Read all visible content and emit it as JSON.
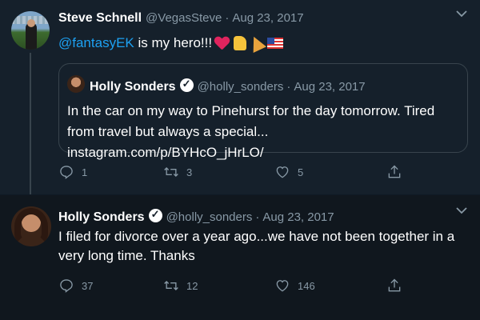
{
  "tweets": [
    {
      "author_name": "Steve Schnell",
      "handle": "@VegasSteve",
      "separator": "·",
      "date": "Aug 23, 2017",
      "mention": "@fantasyEK",
      "text": "is my hero!!!",
      "emojis": [
        "heart",
        "thumbs-up",
        "party-popper",
        "us-flag"
      ],
      "quoted_tweet": {
        "author_name": "Holly Sonders",
        "verified": true,
        "handle": "@holly_sonders",
        "separator": "·",
        "date": "Aug 23, 2017",
        "text": "In the car on my way to Pinehurst for the day tomorrow. Tired from travel but always a special... instagram.com/p/BYHcO_jHrLO/"
      },
      "actions": {
        "replies": "1",
        "retweets": "3",
        "likes": "5"
      }
    },
    {
      "author_name": "Holly Sonders",
      "verified": true,
      "handle": "@holly_sonders",
      "separator": "·",
      "date": "Aug 23, 2017",
      "text": "I filed for divorce over a year ago...we have not been together in a very long time. Thanks",
      "actions": {
        "replies": "37",
        "retweets": "12",
        "likes": "146"
      }
    }
  ],
  "icons": [
    "chevron-down-icon",
    "reply-icon",
    "retweet-icon",
    "like-icon",
    "share-icon",
    "verified-icon"
  ],
  "colors": {
    "background": "#15202b",
    "background_alt": "#10171e",
    "link": "#1da1f2",
    "muted": "#8899a6",
    "border": "#38444d",
    "heart": "#e0245e"
  }
}
